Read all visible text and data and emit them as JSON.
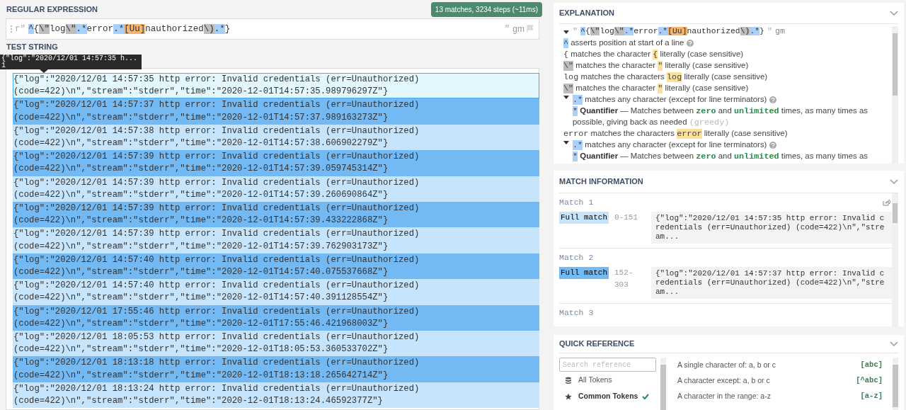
{
  "regex_panel": {
    "title": "REGULAR EXPRESSION",
    "status": "13 matches, 3234 steps (~11ms)",
    "prefix": "r\"",
    "suffix": "\"",
    "flags": "gm",
    "tokens": [
      {
        "kind": "anchor",
        "text": "^"
      },
      {
        "kind": "literal",
        "text": "{"
      },
      {
        "kind": "escape",
        "text": "\\\""
      },
      {
        "kind": "literal",
        "text": "log"
      },
      {
        "kind": "escape",
        "text": "\\\""
      },
      {
        "kind": "quantifier",
        "text": ".*"
      },
      {
        "kind": "literal",
        "text": "error"
      },
      {
        "kind": "quantifier",
        "text": ".*"
      },
      {
        "kind": "class",
        "text": "[Uu]"
      },
      {
        "kind": "literal",
        "text": "nauthorized"
      },
      {
        "kind": "escape",
        "text": "\\)"
      },
      {
        "kind": "quantifier",
        "text": ".*"
      },
      {
        "kind": "literal",
        "text": "}"
      }
    ]
  },
  "test_string": {
    "title": "TEST STRING",
    "tooltip": {
      "text": "{\"log\":\"2020/12/01 14:57:35 h...",
      "group": "1"
    },
    "matches": [
      {
        "selected": true,
        "text": "{\"log\":\"2020/12/01 14:57:35 http error: Invalid credentials (err=Unauthorized) (code=422)\\n\",\"stream\":\"stderr\",\"time\":\"2020-12-01T14:57:35.989796297Z\"}"
      },
      {
        "selected": false,
        "text": "{\"log\":\"2020/12/01 14:57:37 http error: Invalid credentials (err=Unauthorized) (code=422)\\n\",\"stream\":\"stderr\",\"time\":\"2020-12-01T14:57:37.989163273Z\"}"
      },
      {
        "selected": false,
        "text": "{\"log\":\"2020/12/01 14:57:38 http error: Invalid credentials (err=Unauthorized) (code=422)\\n\",\"stream\":\"stderr\",\"time\":\"2020-12-01T14:57:38.606902279Z\"}"
      },
      {
        "selected": false,
        "text": "{\"log\":\"2020/12/01 14:57:39 http error: Invalid credentials (err=Unauthorized) (code=422)\\n\",\"stream\":\"stderr\",\"time\":\"2020-12-01T14:57:39.059745314Z\"}"
      },
      {
        "selected": false,
        "text": "{\"log\":\"2020/12/01 14:57:39 http error: Invalid credentials (err=Unauthorized) (code=422)\\n\",\"stream\":\"stderr\",\"time\":\"2020-12-01T14:57:39.260690864Z\"}"
      },
      {
        "selected": false,
        "text": "{\"log\":\"2020/12/01 14:57:39 http error: Invalid credentials (err=Unauthorized) (code=422)\\n\",\"stream\":\"stderr\",\"time\":\"2020-12-01T14:57:39.433222868Z\"}"
      },
      {
        "selected": false,
        "text": "{\"log\":\"2020/12/01 14:57:39 http error: Invalid credentials (err=Unauthorized) (code=422)\\n\",\"stream\":\"stderr\",\"time\":\"2020-12-01T14:57:39.762903173Z\"}"
      },
      {
        "selected": false,
        "text": "{\"log\":\"2020/12/01 14:57:40 http error: Invalid credentials (err=Unauthorized) (code=422)\\n\",\"stream\":\"stderr\",\"time\":\"2020-12-01T14:57:40.075537668Z\"}"
      },
      {
        "selected": false,
        "text": "{\"log\":\"2020/12/01 14:57:40 http error: Invalid credentials (err=Unauthorized) (code=422)\\n\",\"stream\":\"stderr\",\"time\":\"2020-12-01T14:57:40.391128554Z\"}"
      },
      {
        "selected": false,
        "text": "{\"log\":\"2020/12/01 17:55:46 http error: Invalid credentials (err=Unauthorized) (code=422)\\n\",\"stream\":\"stderr\",\"time\":\"2020-12-01T17:55:46.421968003Z\"}"
      },
      {
        "selected": false,
        "text": "{\"log\":\"2020/12/01 18:05:53 http error: Invalid credentials (err=Unauthorized) (code=422)\\n\",\"stream\":\"stderr\",\"time\":\"2020-12-01T18:05:53.360533702Z\"}"
      },
      {
        "selected": false,
        "text": "{\"log\":\"2020/12/01 18:13:18 http error: Invalid credentials (err=Unauthorized) (code=422)\\n\",\"stream\":\"stderr\",\"time\":\"2020-12-01T18:13:18.265642714Z\"}"
      },
      {
        "selected": false,
        "text": "{\"log\":\"2020/12/01 18:13:24 http error: Invalid credentials (err=Unauthorized) (code=422)\\n\",\"stream\":\"stderr\",\"time\":\"2020-12-01T18:13:24.46592377Z\"}"
      }
    ]
  },
  "explanation": {
    "title": "EXPLANATION",
    "header": {
      "expanded": true,
      "open_quote": "\"",
      "close_quote": "\"",
      "flags": "gm",
      "tokens": [
        {
          "kind": "anchor",
          "text": "^"
        },
        {
          "kind": "literal",
          "text": "{"
        },
        {
          "kind": "escape",
          "text": "\\\""
        },
        {
          "kind": "literal",
          "text": "log"
        },
        {
          "kind": "escape",
          "text": "\\\""
        },
        {
          "kind": "quantifier",
          "text": ".*"
        },
        {
          "kind": "literal",
          "text": "error"
        },
        {
          "kind": "quantifier",
          "text": ".*"
        },
        {
          "kind": "class",
          "text": "[Uu]"
        },
        {
          "kind": "literal",
          "text": "nauthorized"
        },
        {
          "kind": "escape",
          "text": "\\)"
        },
        {
          "kind": "quantifier",
          "text": ".*"
        },
        {
          "kind": "literal",
          "text": "}"
        }
      ]
    },
    "lines": [
      {
        "parts": [
          {
            "kind": "anchor",
            "text": "^"
          },
          {
            "kind": "plain",
            "text": "asserts position at start of a line"
          },
          {
            "kind": "help"
          }
        ]
      },
      {
        "parts": [
          {
            "kind": "literal",
            "text": "{"
          },
          {
            "kind": "plain",
            "text": "matches the character"
          },
          {
            "kind": "highlight",
            "text": "{"
          },
          {
            "kind": "plain",
            "text": "literally (case sensitive)"
          }
        ]
      },
      {
        "parts": [
          {
            "kind": "escape",
            "text": "\\\""
          },
          {
            "kind": "plain",
            "text": "matches the character"
          },
          {
            "kind": "highlight",
            "text": "\""
          },
          {
            "kind": "plain",
            "text": "literally (case sensitive)"
          }
        ]
      },
      {
        "parts": [
          {
            "kind": "literal",
            "text": "log"
          },
          {
            "kind": "plain",
            "text": "matches the characters"
          },
          {
            "kind": "highlight",
            "text": "log"
          },
          {
            "kind": "plain",
            "text": "literally (case sensitive)"
          }
        ]
      },
      {
        "parts": [
          {
            "kind": "escape",
            "text": "\\\""
          },
          {
            "kind": "plain",
            "text": "matches the character"
          },
          {
            "kind": "highlight",
            "text": "\""
          },
          {
            "kind": "plain",
            "text": "literally (case sensitive)"
          }
        ]
      },
      {
        "expanded": true,
        "parts": [
          {
            "kind": "quantifier",
            "text": ".*"
          },
          {
            "kind": "plain",
            "text": "matches any character (except for line terminators)"
          },
          {
            "kind": "help"
          }
        ],
        "children": [
          {
            "parts": [
              {
                "kind": "quantifier",
                "text": "*"
              },
              {
                "kind": "bold",
                "text": "Quantifier"
              },
              {
                "kind": "plain",
                "text": "— Matches between"
              },
              {
                "kind": "keyword",
                "text": "zero"
              },
              {
                "kind": "plain",
                "text": "and"
              },
              {
                "kind": "keyword",
                "text": "unlimited"
              },
              {
                "kind": "plain",
                "text": "times, as many times as possible, giving back as needed"
              },
              {
                "kind": "muted",
                "text": "(greedy)"
              }
            ]
          }
        ]
      },
      {
        "parts": [
          {
            "kind": "literal",
            "text": "error"
          },
          {
            "kind": "plain",
            "text": "matches the characters"
          },
          {
            "kind": "highlight",
            "text": "error"
          },
          {
            "kind": "plain",
            "text": "literally (case sensitive)"
          }
        ]
      },
      {
        "expanded": true,
        "parts": [
          {
            "kind": "quantifier",
            "text": ".*"
          },
          {
            "kind": "plain",
            "text": "matches any character (except for line terminators)"
          },
          {
            "kind": "help"
          }
        ],
        "children": [
          {
            "parts": [
              {
                "kind": "quantifier",
                "text": "*"
              },
              {
                "kind": "bold",
                "text": "Quantifier"
              },
              {
                "kind": "plain",
                "text": "— Matches between"
              },
              {
                "kind": "keyword",
                "text": "zero"
              },
              {
                "kind": "plain",
                "text": "and"
              },
              {
                "kind": "keyword",
                "text": "unlimited"
              },
              {
                "kind": "plain",
                "text": "times, as many times as"
              }
            ]
          }
        ]
      }
    ]
  },
  "match_information": {
    "title": "MATCH INFORMATION",
    "matches": [
      {
        "title": "Match 1",
        "label": "Full match",
        "range": "0-151",
        "text": "{\"log\":\"2020/12/01 14:57:35 http error: Invalid credentials (err=Unauthorized) (code=422)\\n\",\"stream...",
        "share": true
      },
      {
        "title": "Match 2",
        "label": "Full match",
        "range": "152-303",
        "text": "{\"log\":\"2020/12/01 14:57:37 http error: Invalid credentials (err=Unauthorized) (code=422)\\n\",\"stream...",
        "share": false
      },
      {
        "title": "Match 3"
      }
    ]
  },
  "quick_reference": {
    "title": "QUICK REFERENCE",
    "search": {
      "placeholder": "Search reference"
    },
    "categories": [
      {
        "label": "All Tokens",
        "selected": false
      },
      {
        "label": "Common Tokens",
        "selected": true
      }
    ],
    "items": [
      {
        "description": "A single character of: a, b or c",
        "token": "[abc]"
      },
      {
        "description": "A character except: a, b or c",
        "token": "[^abc]"
      },
      {
        "description": "A character in the range: a-z",
        "token": "[a-z]"
      }
    ]
  }
}
